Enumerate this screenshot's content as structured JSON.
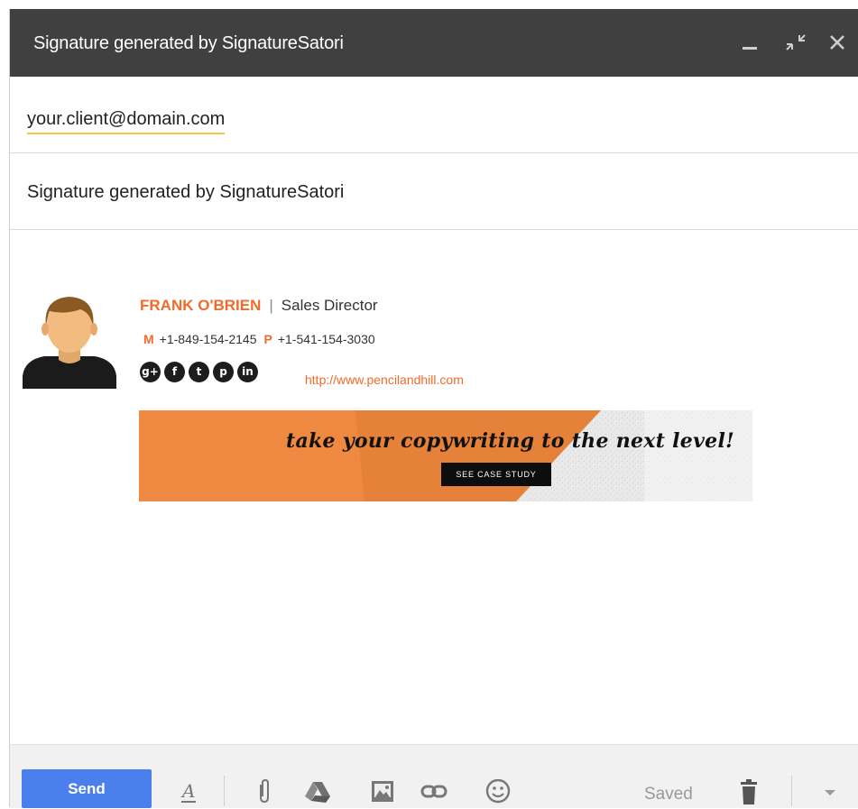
{
  "window": {
    "title": "Signature generated by SignatureSatori",
    "minimize_icon": "minimize-icon",
    "popout_icon": "exit-fullscreen-icon",
    "close_icon": "close-icon"
  },
  "compose": {
    "to": "your.client@domain.com",
    "subject": "Signature generated by SignatureSatori"
  },
  "signature": {
    "name": "FRANK O'BRIEN",
    "separator": "|",
    "title": "Sales Director",
    "mobile_label": "M",
    "mobile": "+1-849-154-2145",
    "phone_label": "P",
    "phone": "+1-541-154-3030",
    "social": [
      {
        "icon": "google-plus-icon",
        "glyph": "g+"
      },
      {
        "icon": "facebook-icon",
        "glyph": "f"
      },
      {
        "icon": "twitter-icon",
        "glyph": "t"
      },
      {
        "icon": "pinterest-icon",
        "glyph": "p"
      },
      {
        "icon": "linkedin-icon",
        "glyph": "in"
      }
    ],
    "url": "http://www.pencilandhill.com",
    "banner": {
      "headline": "take your copywriting to the next level!",
      "button": "SEE CASE STUDY"
    },
    "accent_color": "#f26b2a"
  },
  "toolbar": {
    "send_label": "Send",
    "saved_label": "Saved",
    "icons": [
      "formatting-icon",
      "attach-icon",
      "drive-icon",
      "photo-icon",
      "link-icon",
      "emoji-icon",
      "trash-icon",
      "more-options-icon"
    ],
    "send_color": "#4a7fed"
  }
}
